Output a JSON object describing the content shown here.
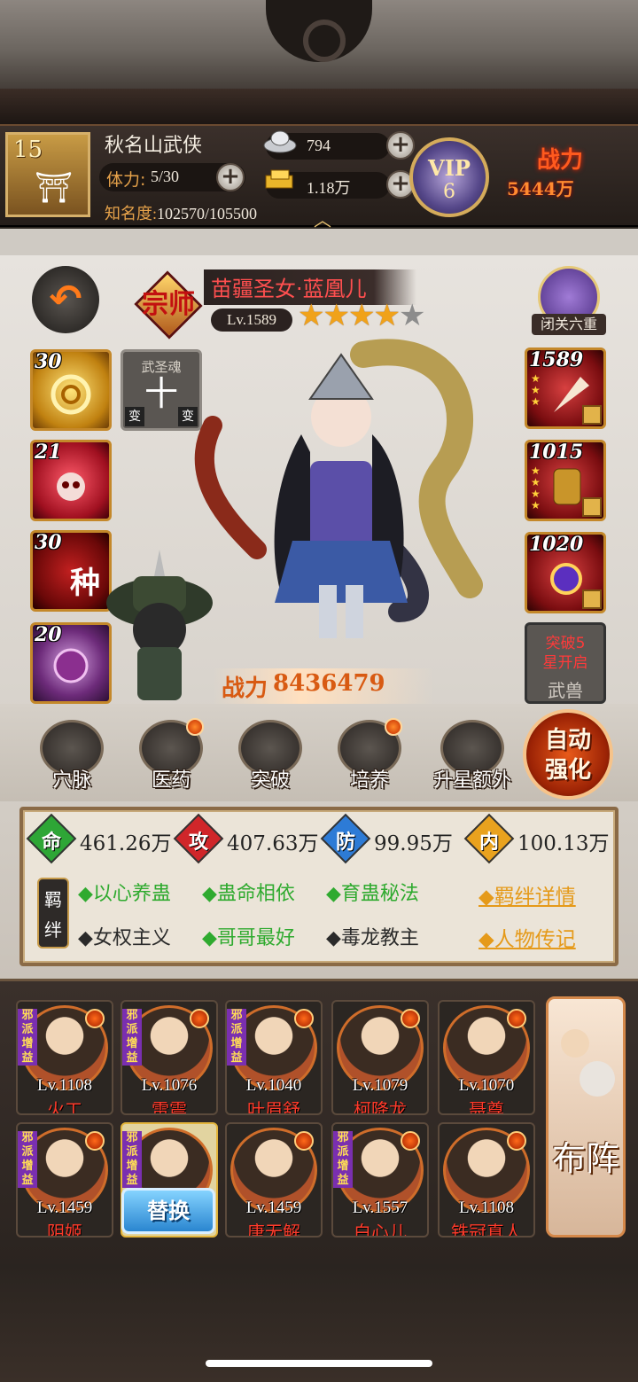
{
  "player": {
    "level": "15",
    "name": "秋名山武侠",
    "stamina_label": "体力:",
    "stamina_value": "5/30",
    "fame_label": "知名度:",
    "fame_value": "102570/105500"
  },
  "currency": {
    "silver": "794",
    "gold": "1.18万"
  },
  "vip": {
    "label": "VIP",
    "level": "6"
  },
  "power_top": {
    "label": "战力",
    "value": "5444万"
  },
  "hero": {
    "badge": "宗师",
    "name": "苗疆圣女·蓝凰儿",
    "level": "Lv.1589",
    "stars_on": 4,
    "stars_total": 5,
    "combat_label": "战力",
    "combat_value": "8436479"
  },
  "seclusion_label": "闭关六重",
  "left_slots": [
    {
      "num": "30",
      "color": "gold",
      "glyph": ""
    },
    {
      "num": "21",
      "color": "red",
      "glyph": ""
    },
    {
      "num": "30",
      "color": "dred",
      "glyph": "种"
    },
    {
      "num": "20",
      "color": "purple",
      "glyph": ""
    }
  ],
  "soul": {
    "title": "武圣魂",
    "glyph": "十",
    "left": "变",
    "right": "变"
  },
  "right_slots": [
    {
      "num": "1589"
    },
    {
      "num": "1015"
    },
    {
      "num": "1020"
    }
  ],
  "beast": {
    "line1": "突破5",
    "line2": "星开启",
    "label": "武兽"
  },
  "features": [
    {
      "label": "穴脉",
      "dot": false,
      "icon": "meridian-icon"
    },
    {
      "label": "医药",
      "dot": true,
      "icon": "medicine-icon"
    },
    {
      "label": "突破",
      "dot": false,
      "icon": "breakthrough-icon"
    },
    {
      "label": "培养",
      "dot": true,
      "icon": "cultivate-icon"
    },
    {
      "label": "升星额外",
      "dot": false,
      "icon": "star-up-icon"
    }
  ],
  "auto_strengthen": {
    "line1": "自动",
    "line2": "强化"
  },
  "stats": [
    {
      "badge": "命",
      "value": "461.26万",
      "color": "#2ea636"
    },
    {
      "badge": "攻",
      "value": "407.63万",
      "color": "#d0262a"
    },
    {
      "badge": "防",
      "value": "99.95万",
      "color": "#2d7bd6"
    },
    {
      "badge": "内",
      "value": "100.13万",
      "color": "#e9a21e"
    }
  ],
  "bond_label": "羁绊",
  "bonds": [
    {
      "text": "◆以心养蛊",
      "active": true
    },
    {
      "text": "◆蛊命相依",
      "active": true
    },
    {
      "text": "◆育蛊秘法",
      "active": true
    },
    {
      "text": "◆女权主义",
      "active": false
    },
    {
      "text": "◆哥哥最好",
      "active": true
    },
    {
      "text": "◆毒龙教主",
      "active": false
    }
  ],
  "links": {
    "bond_detail": "◆羁绊详情",
    "biography": "◆人物传记"
  },
  "roster": [
    {
      "level": "Lv.1108",
      "name": "火工",
      "evil": true
    },
    {
      "level": "Lv.1076",
      "name": "雷震",
      "evil": true
    },
    {
      "level": "Lv.1040",
      "name": "叶眉舒",
      "evil": true
    },
    {
      "level": "Lv.1079",
      "name": "柯降龙",
      "evil": false
    },
    {
      "level": "Lv.1070",
      "name": "聂尊",
      "evil": false
    },
    {
      "level": "Lv.1459",
      "name": "阴姬",
      "evil": true
    },
    {
      "level": "",
      "name": "",
      "evil": true,
      "selected": true
    },
    {
      "level": "Lv.1459",
      "name": "唐无解",
      "evil": false
    },
    {
      "level": "Lv.1557",
      "name": "白心儿",
      "evil": true
    },
    {
      "level": "Lv.1108",
      "name": "铁冠真人",
      "evil": false
    }
  ],
  "evil_tag": "邪派增益",
  "swap_label": "替换",
  "formation_label": "布阵"
}
